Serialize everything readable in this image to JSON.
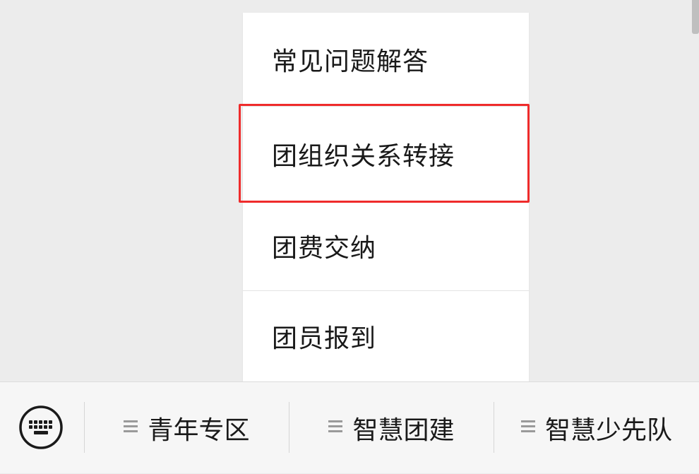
{
  "popup_menu": {
    "items": [
      {
        "label": "常见问题解答"
      },
      {
        "label": "团组织关系转接",
        "highlighted": true
      },
      {
        "label": "团费交纳"
      },
      {
        "label": "团员报到"
      }
    ],
    "highlight_color": "#ef2b2b"
  },
  "bottom_bar": {
    "keyboard_icon": "keyboard-icon",
    "menus": [
      {
        "label": "青年专区",
        "icon": "menu-lines-icon"
      },
      {
        "label": "智慧团建",
        "icon": "menu-lines-icon"
      },
      {
        "label": "智慧少先队",
        "icon": "menu-lines-icon"
      }
    ]
  }
}
